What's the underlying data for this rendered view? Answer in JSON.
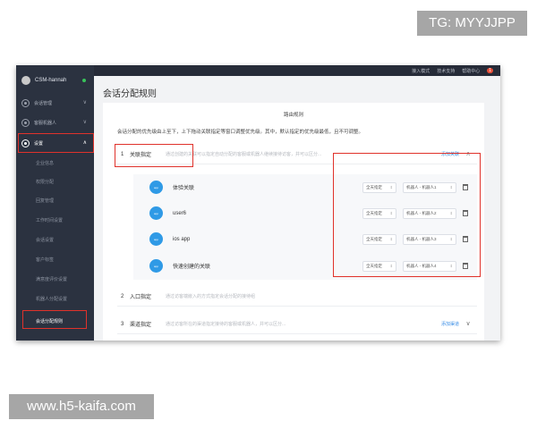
{
  "watermark_top": "TG: MYYJJPP",
  "watermark_bottom": "www.h5-kaifa.com",
  "topbar": {
    "links": [
      "接入模式",
      "技术支持",
      "帮助中心"
    ],
    "badge": "1"
  },
  "sidebar": {
    "user_name": "CSM-hannah",
    "menu": [
      {
        "label": "会话管理",
        "icon": "chat-icon",
        "expanded": false
      },
      {
        "label": "客服机器人",
        "icon": "robot-icon",
        "expanded": false
      },
      {
        "label": "设置",
        "icon": "gear-icon",
        "expanded": true
      }
    ],
    "sub_items": [
      {
        "label": "企业信息"
      },
      {
        "label": "权限分配"
      },
      {
        "label": "回复管理"
      },
      {
        "label": "工作时间设置"
      },
      {
        "label": "会话设置"
      },
      {
        "label": "客户标签"
      },
      {
        "label": "满意度评价设置"
      },
      {
        "label": "机器人分配设置"
      },
      {
        "label": "会话分配规则",
        "active": true
      }
    ]
  },
  "main": {
    "page_title": "会话分配规则",
    "card_title": "路由规则",
    "description": "会话分配的优先级由上至下，上下拖动关联指定等窗口调整优先级。其中，默认指定的优先级最低，且不可调整。",
    "groups": [
      {
        "num": "1",
        "name": "关联指定",
        "input": "通过创建的关联可以指定自动分配的客服或机器人继续接待访客，并可以区分...",
        "add": "添加关联",
        "chevron": "∧"
      },
      {
        "num": "2",
        "name": "入口指定",
        "input": "通过访客端嵌入的方式指定会话分配的接待组",
        "add": "",
        "chevron": ""
      },
      {
        "num": "3",
        "name": "渠道指定",
        "input": "通过访客所在的渠道指定接待的客服或机器人，并可以区分...",
        "add": "添加渠道",
        "chevron": "∨"
      }
    ],
    "rules": [
      {
        "icon_text": "app",
        "name": "体验关联",
        "mode": "全天指定",
        "assign": "机器人 - 机器人1"
      },
      {
        "icon_text": "app",
        "name": "user6",
        "mode": "全天指定",
        "assign": "机器人 - 机器人2"
      },
      {
        "icon_text": "app",
        "name": "ios app",
        "mode": "全天指定",
        "assign": "机器人 - 机器人3"
      },
      {
        "icon_text": "app",
        "name": "快速创建的关联",
        "mode": "全天指定",
        "assign": "机器人 - 机器人4"
      }
    ]
  },
  "colors": {
    "sidebar_bg": "#2b3240",
    "topbar_bg": "#262b38",
    "highlight_red": "#e0322b",
    "accent_blue": "#2f9ae6",
    "link_blue": "#3a8ee6"
  }
}
